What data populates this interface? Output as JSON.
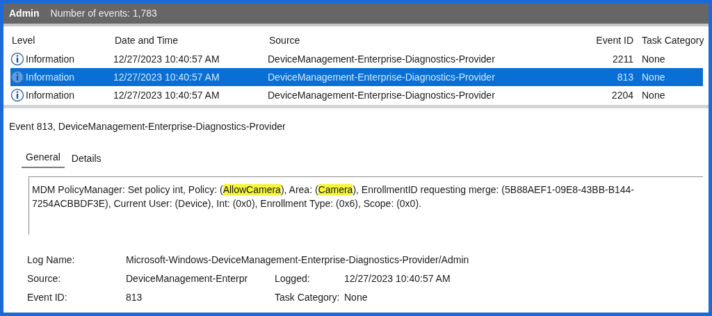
{
  "log_header": {
    "log_name": "Admin",
    "event_count": "Number of events: 1,783"
  },
  "table": {
    "columns": [
      "Level",
      "Date and Time",
      "Source",
      "Event ID",
      "Task Category"
    ],
    "rows": [
      {
        "level": "Information",
        "date_time": "12/27/2023 10:40:57 AM",
        "source": "DeviceManagement-Enterprise-Diagnostics-Provider",
        "event_id": "2211",
        "task_category": "None",
        "selected": false
      },
      {
        "level": "Information",
        "date_time": "12/27/2023 10:40:57 AM",
        "source": "DeviceManagement-Enterprise-Diagnostics-Provider",
        "event_id": "813",
        "task_category": "None",
        "selected": true
      },
      {
        "level": "Information",
        "date_time": "12/27/2023 10:40:57 AM",
        "source": "DeviceManagement-Enterprise-Diagnostics-Provider",
        "event_id": "2204",
        "task_category": "None",
        "selected": false
      }
    ]
  },
  "details": {
    "title": "Event 813, DeviceManagement-Enterprise-Diagnostics-Provider",
    "tabs": [
      {
        "label": "General",
        "selected": true
      },
      {
        "label": "Details",
        "selected": false
      }
    ],
    "message": [
      {
        "text": "MDM PolicyManager: Set policy int, Policy: (",
        "highlighted": false
      },
      {
        "text": "AllowCamera",
        "highlighted": true
      },
      {
        "text": "), Area: (",
        "highlighted": false
      },
      {
        "text": "Camera",
        "highlighted": true
      },
      {
        "text": "), EnrollmentID requesting merge: (5B88AEF1-09E8-43BB-B144-7254ACBBDF3E), Current User: (Device), Int: (0x0), Enrollment Type: (0x6), Scope: (0x0).",
        "highlighted": false
      }
    ],
    "log_name": {
      "label": "Log Name:",
      "value": "Microsoft-Windows-DeviceManagement-Enterprise-Diagnostics-Provider/Admin"
    },
    "source": {
      "label": "Source:",
      "value": "DeviceManagement-Enterpr"
    },
    "logged": {
      "label": "Logged:",
      "value": "12/27/2023 10:40:57 AM"
    },
    "event_id": {
      "label": "Event ID:",
      "value": "813"
    },
    "task_category": {
      "label": "Task Category:",
      "value": "None"
    }
  }
}
